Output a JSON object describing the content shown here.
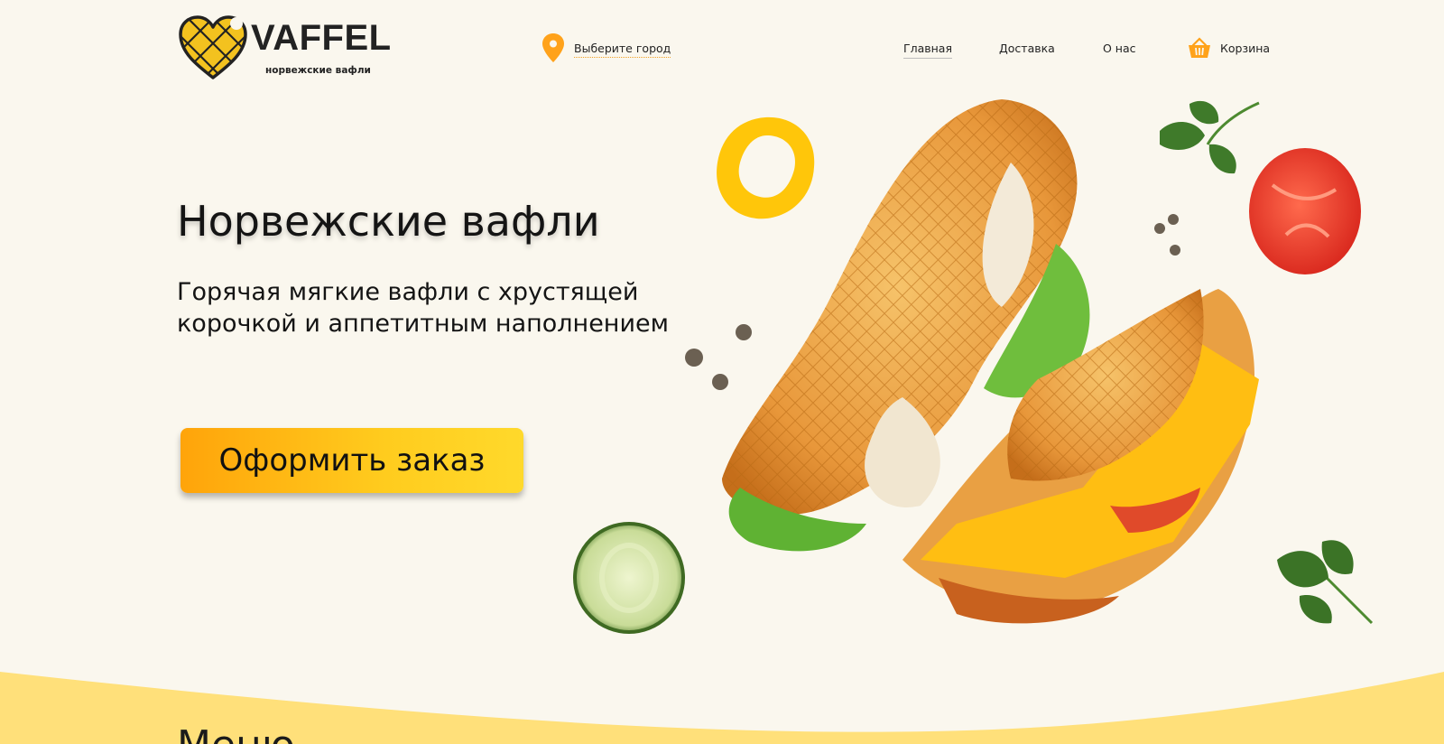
{
  "header": {
    "logo": {
      "word": "VAFFEL",
      "tagline": "норвежские вафли"
    },
    "city_selector": {
      "label": "Выберите город",
      "icon": "location-pin-icon"
    },
    "nav": [
      {
        "label": "Главная",
        "active": true
      },
      {
        "label": "Доставка",
        "active": false
      },
      {
        "label": "О нас",
        "active": false
      }
    ],
    "cart": {
      "label": "Корзина",
      "icon": "basket-icon"
    }
  },
  "hero": {
    "title": "Норвежские вафли",
    "subtitle": "Горячая мягкие вафли с хрустящей корочкой и аппетитным наполнением",
    "order_button": "Оформить заказ"
  },
  "next_section": {
    "title": "Меню"
  },
  "colors": {
    "background": "#faf7ee",
    "accent_orange": "#ffa40a",
    "accent_yellow": "#ffd92b",
    "logo_yellow": "#f3c21f",
    "wave_yellow": "#ffe07a",
    "text": "#141414"
  }
}
